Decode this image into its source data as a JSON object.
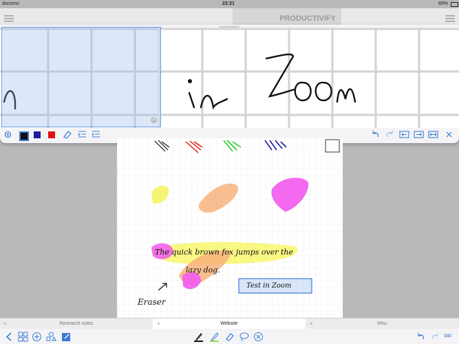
{
  "status": {
    "carrier": "docomo",
    "time": "23:21",
    "battery": "89%"
  },
  "logo_text": "PRODUCTIVIFY",
  "zoom": {
    "handwriting": "n   in Zoom",
    "close_glyph": "×"
  },
  "swatches": [
    "#111111",
    "#1b1b9e",
    "#e01212"
  ],
  "page": {
    "handwriting_line1": "The quick brown fox jumps over the",
    "handwriting_line2": "lazy dog.",
    "textbox": "Test in Zoom",
    "eraser_label": "Eraser"
  },
  "tabs": [
    {
      "label": "Research notes",
      "close": "×"
    },
    {
      "label": "Website",
      "close": "×"
    },
    {
      "label": "Misc",
      "close": "×"
    }
  ],
  "bottom": {
    "more": "ooo"
  }
}
